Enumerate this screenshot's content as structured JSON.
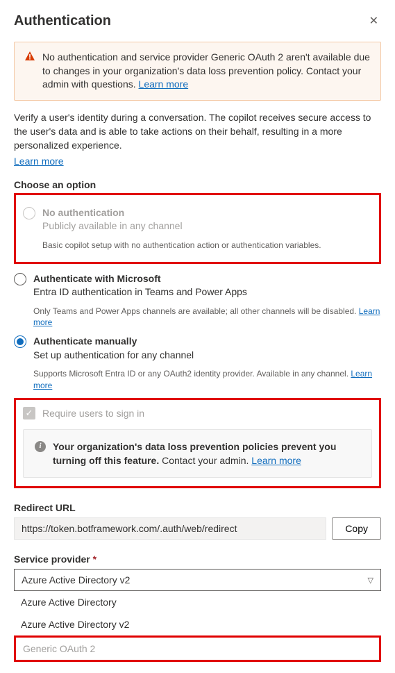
{
  "header": {
    "title": "Authentication"
  },
  "alert": {
    "text": "No authentication and service provider Generic OAuth 2 aren't available due to changes in your organization's data loss prevention policy. Contact your admin with questions. ",
    "link": "Learn more"
  },
  "intro": {
    "text": "Verify a user's identity during a conversation. The copilot receives secure access to the user's data and is able to take actions on their behalf, resulting in a more personalized experience. ",
    "link": "Learn more"
  },
  "choose_label": "Choose an option",
  "options": {
    "none": {
      "title": "No authentication",
      "sub": "Publicly available in any channel",
      "hint": "Basic copilot setup with no authentication action or authentication variables."
    },
    "ms": {
      "title": "Authenticate with Microsoft",
      "sub": "Entra ID authentication in Teams and Power Apps",
      "hint": "Only Teams and Power Apps channels are available; all other channels will be disabled. ",
      "hint_link": "Learn more"
    },
    "manual": {
      "title": "Authenticate manually",
      "sub": "Set up authentication for any channel",
      "hint": "Supports Microsoft Entra ID or any OAuth2 identity provider. Available in any channel. ",
      "hint_link": "Learn more"
    }
  },
  "require": {
    "label": "Require users to sign in",
    "info_bold": "Your organization's data loss prevention policies prevent you turning off this feature.",
    "info_rest": " Contact your admin. ",
    "info_link": "Learn more"
  },
  "redirect": {
    "label": "Redirect URL",
    "value": "https://token.botframework.com/.auth/web/redirect",
    "copy": "Copy"
  },
  "provider": {
    "label": "Service provider ",
    "selected": "Azure Active Directory v2",
    "opt1": "Azure Active Directory",
    "opt2": "Azure Active Directory v2",
    "opt3": "Generic OAuth 2"
  }
}
